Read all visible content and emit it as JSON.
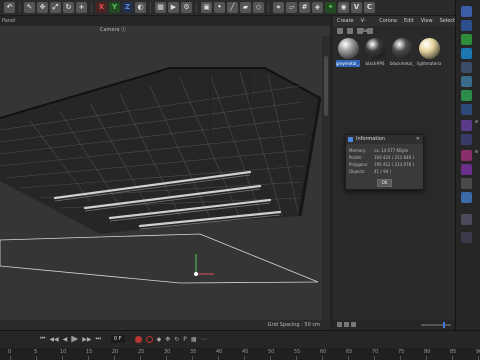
{
  "toolbar": {
    "axis_x": "X",
    "axis_y": "Y",
    "axis_z": "Z"
  },
  "viewport": {
    "panel_label": "Panel",
    "camera_label": "Camera",
    "camera_suffix": "Ⓘ",
    "grid_spacing": "Grid Spacing : 50 cm"
  },
  "timeline": {
    "current_frame": "0 F",
    "ticks": [
      "0",
      "5",
      "10",
      "15",
      "20",
      "25",
      "30",
      "35",
      "40",
      "45",
      "50",
      "55",
      "60",
      "65",
      "70",
      "75",
      "80",
      "85",
      "90"
    ]
  },
  "material_manager": {
    "menu": [
      "Create",
      "V-Ray",
      "Corona",
      "Edit",
      "View",
      "Select"
    ],
    "materials": [
      {
        "name": "greymetal_...",
        "color": "#9a9a9a",
        "selected": true
      },
      {
        "name": "black#PS",
        "color": "#3a3a3a",
        "selected": false
      },
      {
        "name": "blackmetal_...",
        "color": "#4a4a4a",
        "selected": false
      },
      {
        "name": "lightmaterial...",
        "color": "#e8d6a0",
        "selected": false
      }
    ]
  },
  "info_dialog": {
    "title": "Information",
    "close": "✕",
    "rows": [
      {
        "key": "Memory:",
        "value": "ca. 14 077 KByte"
      },
      {
        "key": "Points:",
        "value": "193 424 ( 211 640 )"
      },
      {
        "key": "Polygons:",
        "value": "195 412 ( 213 078 )"
      },
      {
        "key": "Objects:",
        "value": "41 ( 94 )"
      }
    ],
    "ok_label": "OK"
  },
  "colors": {
    "accent": "#2f64b5",
    "axis_x": "#e05050",
    "axis_y": "#57c857",
    "axis_z": "#5a8ae6"
  }
}
